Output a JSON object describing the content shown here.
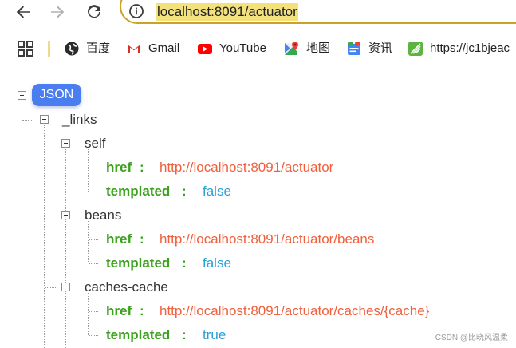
{
  "browser": {
    "url": "localhost:8091/actuator",
    "back_icon": "arrow-left",
    "forward_icon": "arrow-right",
    "reload_icon": "reload",
    "info_icon": "info-circle"
  },
  "bookmarks": [
    {
      "label": "百度",
      "icon": "globe-icon"
    },
    {
      "label": "Gmail",
      "icon": "gmail-icon"
    },
    {
      "label": "YouTube",
      "icon": "youtube-icon"
    },
    {
      "label": "地图",
      "icon": "maps-icon"
    },
    {
      "label": "资讯",
      "icon": "news-icon"
    },
    {
      "label": "https://jc1bjeac",
      "icon": "leaf-icon"
    }
  ],
  "json_viewer": {
    "root_label": "JSON",
    "links_key": "_links",
    "nodes": [
      {
        "key": "self",
        "href_key": "href",
        "href_value": "http://localhost:8091/actuator",
        "templated_key": "templated",
        "templated_value": "false"
      },
      {
        "key": "beans",
        "href_key": "href",
        "href_value": "http://localhost:8091/actuator/beans",
        "templated_key": "templated",
        "templated_value": "false"
      },
      {
        "key": "caches-cache",
        "href_key": "href",
        "href_value": "http://localhost:8091/actuator/caches/{cache}",
        "templated_key": "templated",
        "templated_value": "true"
      }
    ],
    "colon": ":"
  },
  "watermark": "CSDN @比晓风温柔",
  "colors": {
    "url_highlight": "#f3e27b",
    "omnibox_border": "#c9a227",
    "json_badge": "#4a7df0",
    "key_green": "#3aa11c",
    "string_orange": "#f0603c",
    "bool_blue": "#2a9fd6"
  }
}
